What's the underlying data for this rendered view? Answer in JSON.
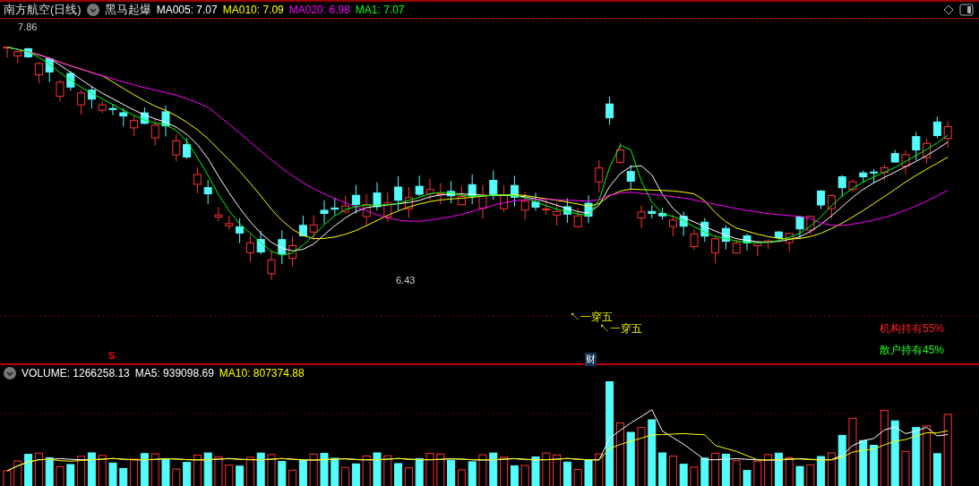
{
  "header": {
    "stock": "南方航空(日线)",
    "indicator": "黑马起爆",
    "ma": [
      {
        "label": "MA005: 7.07",
        "color": "#ffffff"
      },
      {
        "label": "MA010: 7.09",
        "color": "#ffff00"
      },
      {
        "label": "MA020: 6.98",
        "color": "#ff00ff"
      },
      {
        "label": "MA1: 7.07",
        "color": "#00ff00"
      }
    ]
  },
  "price_labels": {
    "high": "7.86",
    "low": "6.43"
  },
  "signals": [
    {
      "text": "↖一穿五"
    },
    {
      "text": "↖一穿五"
    }
  ],
  "marks": {
    "s_mark": "S",
    "finance": "财"
  },
  "holdings": [
    {
      "label": "机构持有55%",
      "color": "#ff2020"
    },
    {
      "label": "散户持有45%",
      "color": "#20ff20"
    }
  ],
  "volume_header": [
    {
      "label": "VOLUME: 1266258.13",
      "color": "#ffffff"
    },
    {
      "label": "MA5: 939098.69",
      "color": "#ffffff"
    },
    {
      "label": "MA10: 807374.88",
      "color": "#ffff00"
    }
  ]
}
